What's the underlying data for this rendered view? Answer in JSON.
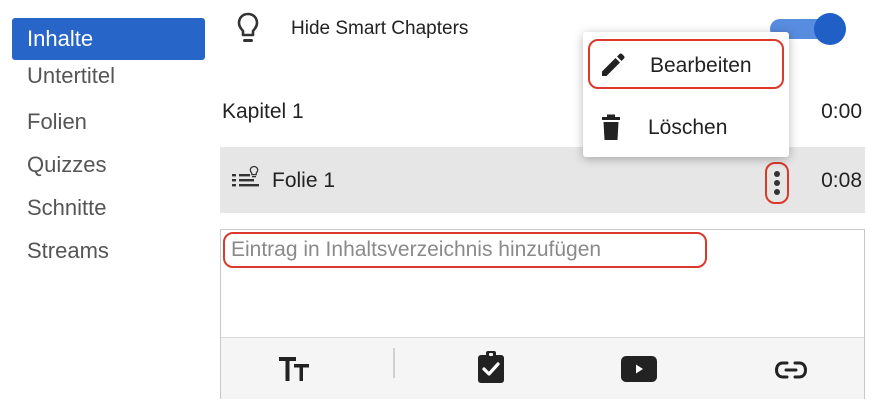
{
  "sidebar": {
    "items": [
      {
        "label": "Inhalte",
        "active": true
      },
      {
        "label": "Untertitel"
      },
      {
        "label": "Folien"
      },
      {
        "label": "Quizzes"
      },
      {
        "label": "Schnitte"
      },
      {
        "label": "Streams"
      }
    ]
  },
  "header": {
    "hide_label": "Hide Smart Chapters",
    "toggle_on": true
  },
  "chapters": {
    "kapitel": {
      "label": "Kapitel 1",
      "time": "0:00"
    },
    "folie": {
      "label": "Folie 1",
      "time": "0:08"
    }
  },
  "menu": {
    "edit_label": "Bearbeiten",
    "delete_label": "Löschen"
  },
  "editor": {
    "placeholder": "Eintrag in Inhaltsverzeichnis hinzufügen"
  },
  "toolbar": {
    "icons": [
      "text-size-icon",
      "clipboard-check-icon",
      "video-play-icon",
      "link-icon"
    ]
  },
  "colors": {
    "accent": "#2765c9",
    "highlight_outline": "#d93a2b",
    "row_bg": "#e6e6e6"
  }
}
